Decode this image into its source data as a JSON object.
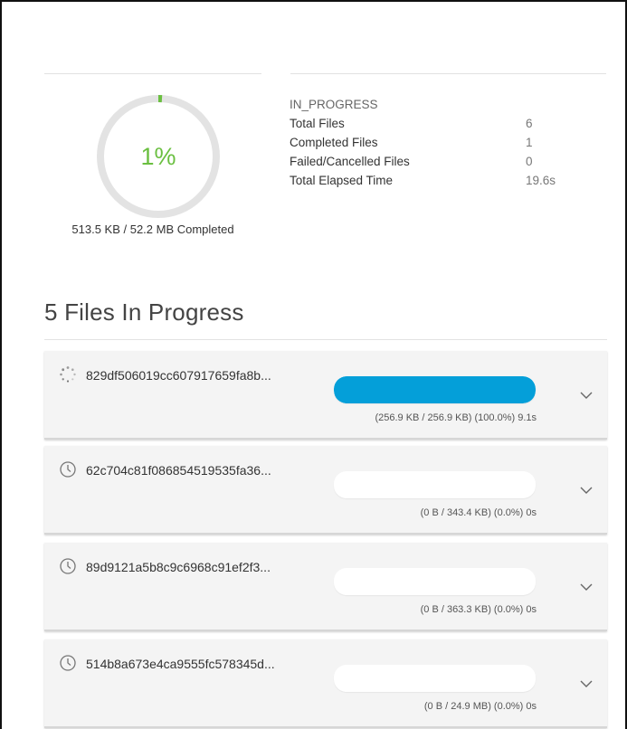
{
  "summary": {
    "percent_label": "1%",
    "percent_value": 1,
    "size_completed": "513.5 KB / 52.2 MB Completed",
    "status": "IN_PROGRESS",
    "stats": [
      {
        "label": "Total Files",
        "value": "6"
      },
      {
        "label": "Completed Files",
        "value": "1"
      },
      {
        "label": "Failed/Cancelled Files",
        "value": "0"
      },
      {
        "label": "Total Elapsed Time",
        "value": "19.6s"
      }
    ]
  },
  "section_title": "5 Files In Progress",
  "files": [
    {
      "name": "829df506019cc607917659fa8b...",
      "detail": "(256.9 KB / 256.9 KB) (100.0%) 9.1s",
      "progress": 1.0,
      "state_icon": "loading-spinner-icon"
    },
    {
      "name": "62c704c81f086854519535fa36...",
      "detail": "(0 B / 343.4 KB) (0.0%) 0s",
      "progress": 0.0,
      "state_icon": "clock-icon"
    },
    {
      "name": "89d9121a5b8c9c6968c91ef2f3...",
      "detail": "(0 B / 363.3 KB) (0.0%) 0s",
      "progress": 0.0,
      "state_icon": "clock-icon"
    },
    {
      "name": "514b8a673e4ca9555fc578345d...",
      "detail": "(0 B / 24.9 MB) (0.0%) 0s",
      "progress": 0.0,
      "state_icon": "clock-icon"
    }
  ],
  "colors": {
    "progress_fill": "#049fd9",
    "percent_text": "#6abf40",
    "donut_track": "#e3e3e3",
    "donut_arc": "#6abf40"
  }
}
